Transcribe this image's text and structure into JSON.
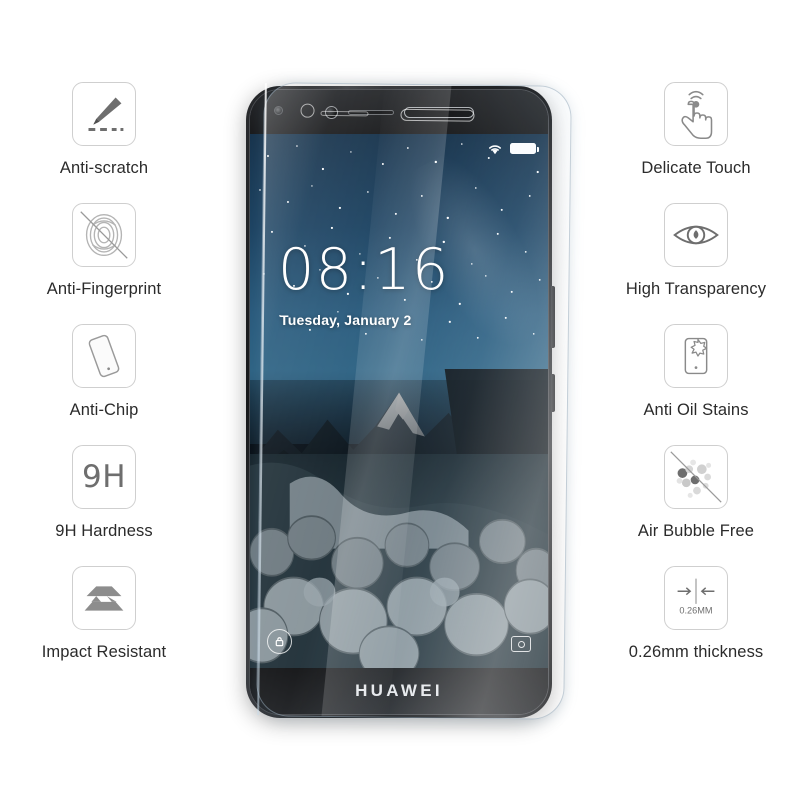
{
  "product": {
    "brand": "HUAWEI",
    "thickness_badge": "0.26MM"
  },
  "features_left": [
    {
      "icon": "knife-scratch-icon",
      "label": "Anti-scratch"
    },
    {
      "icon": "fingerprint-icon",
      "label": "Anti-Fingerprint"
    },
    {
      "icon": "phone-tilted-icon",
      "label": "Anti-Chip"
    },
    {
      "icon": "hardness-9h-icon",
      "label": "9H Hardness"
    },
    {
      "icon": "impact-layers-icon",
      "label": "Impact Resistant"
    }
  ],
  "features_right": [
    {
      "icon": "touch-hand-icon",
      "label": "Delicate Touch"
    },
    {
      "icon": "eye-icon",
      "label": "High Transparency"
    },
    {
      "icon": "oil-stain-phone-icon",
      "label": "Anti Oil Stains"
    },
    {
      "icon": "air-bubbles-icon",
      "label": "Air Bubble Free"
    },
    {
      "icon": "thickness-arrows-icon",
      "label": "0.26mm thickness"
    }
  ],
  "hardness_text": "9H",
  "phone_screen": {
    "clock": "08:16",
    "date": "Tuesday, January 2",
    "status_icons": [
      "wifi-icon",
      "battery-full-icon"
    ],
    "lock_shortcut": "lock-icon",
    "camera_shortcut": "camera-icon",
    "wallpaper": "night mountain river"
  },
  "colors": {
    "background": "#ffffff",
    "label_text": "#2b2b2b",
    "icon_stroke": "#7a7a7a",
    "icon_border": "#cfcfcf",
    "phone_body": "#1b1c1e",
    "sky": "#2a5b7d"
  }
}
